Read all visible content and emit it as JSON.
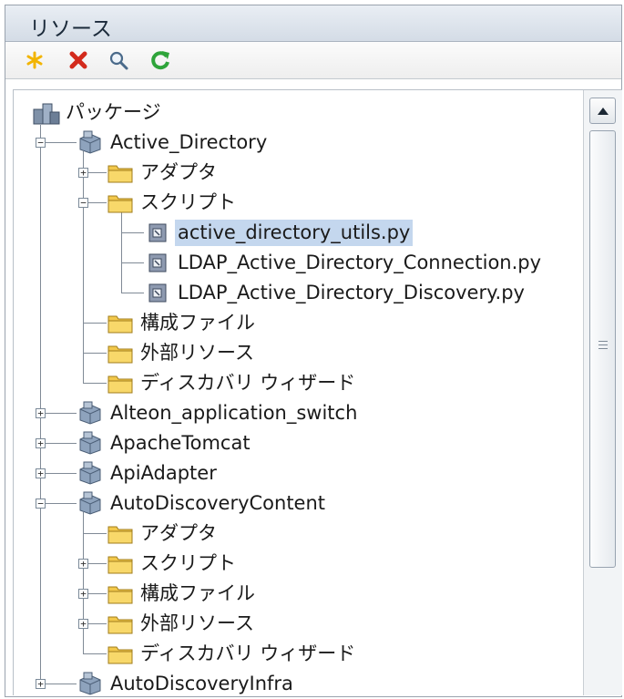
{
  "panel": {
    "title": "リソース"
  },
  "toolbar": {
    "buttons": [
      {
        "name": "new",
        "icon": "asterisk-icon",
        "color": "#f2b400"
      },
      {
        "name": "delete",
        "icon": "x-icon",
        "color": "#d32a1c"
      },
      {
        "name": "search",
        "icon": "magnifier-icon",
        "color": "#4a6a8a"
      },
      {
        "name": "refresh",
        "icon": "refresh-icon",
        "color": "#2ea43a"
      }
    ]
  },
  "tree": {
    "root_label": "パッケージ",
    "nodes": [
      {
        "label": "Active_Directory",
        "type": "package",
        "level": 1,
        "expander": "minus"
      },
      {
        "label": "アダプタ",
        "type": "folder",
        "level": 2,
        "expander": "plus"
      },
      {
        "label": "スクリプト",
        "type": "folder",
        "level": 2,
        "expander": "minus"
      },
      {
        "label": "active_directory_utils.py",
        "type": "file",
        "level": 3,
        "selected": true
      },
      {
        "label": "LDAP_Active_Directory_Connection.py",
        "type": "file",
        "level": 3
      },
      {
        "label": "LDAP_Active_Directory_Discovery.py",
        "type": "file",
        "level": 3
      },
      {
        "label": "構成ファイル",
        "type": "folder",
        "level": 2
      },
      {
        "label": "外部リソース",
        "type": "folder",
        "level": 2
      },
      {
        "label": "ディスカバリ ウィザード",
        "type": "folder",
        "level": 2
      },
      {
        "label": "Alteon_application_switch",
        "type": "package",
        "level": 1,
        "expander": "plus"
      },
      {
        "label": "ApacheTomcat",
        "type": "package",
        "level": 1,
        "expander": "plus"
      },
      {
        "label": "ApiAdapter",
        "type": "package",
        "level": 1,
        "expander": "plus"
      },
      {
        "label": "AutoDiscoveryContent",
        "type": "package",
        "level": 1,
        "expander": "minus"
      },
      {
        "label": "アダプタ",
        "type": "folder",
        "level": 2
      },
      {
        "label": "スクリプト",
        "type": "folder",
        "level": 2,
        "expander": "plus"
      },
      {
        "label": "構成ファイル",
        "type": "folder",
        "level": 2,
        "expander": "plus"
      },
      {
        "label": "外部リソース",
        "type": "folder",
        "level": 2,
        "expander": "plus"
      },
      {
        "label": "ディスカバリ ウィザード",
        "type": "folder",
        "level": 2
      },
      {
        "label": "AutoDiscoveryInfra",
        "type": "package",
        "level": 1,
        "expander": "plus"
      }
    ]
  },
  "scrollbar": {
    "up_icon": "arrow-up-icon",
    "grip_icon": "grip-icon"
  },
  "colors": {
    "selection": "#c4d7ee",
    "folder": "#f2c84b",
    "package": "#8ea3bd"
  }
}
